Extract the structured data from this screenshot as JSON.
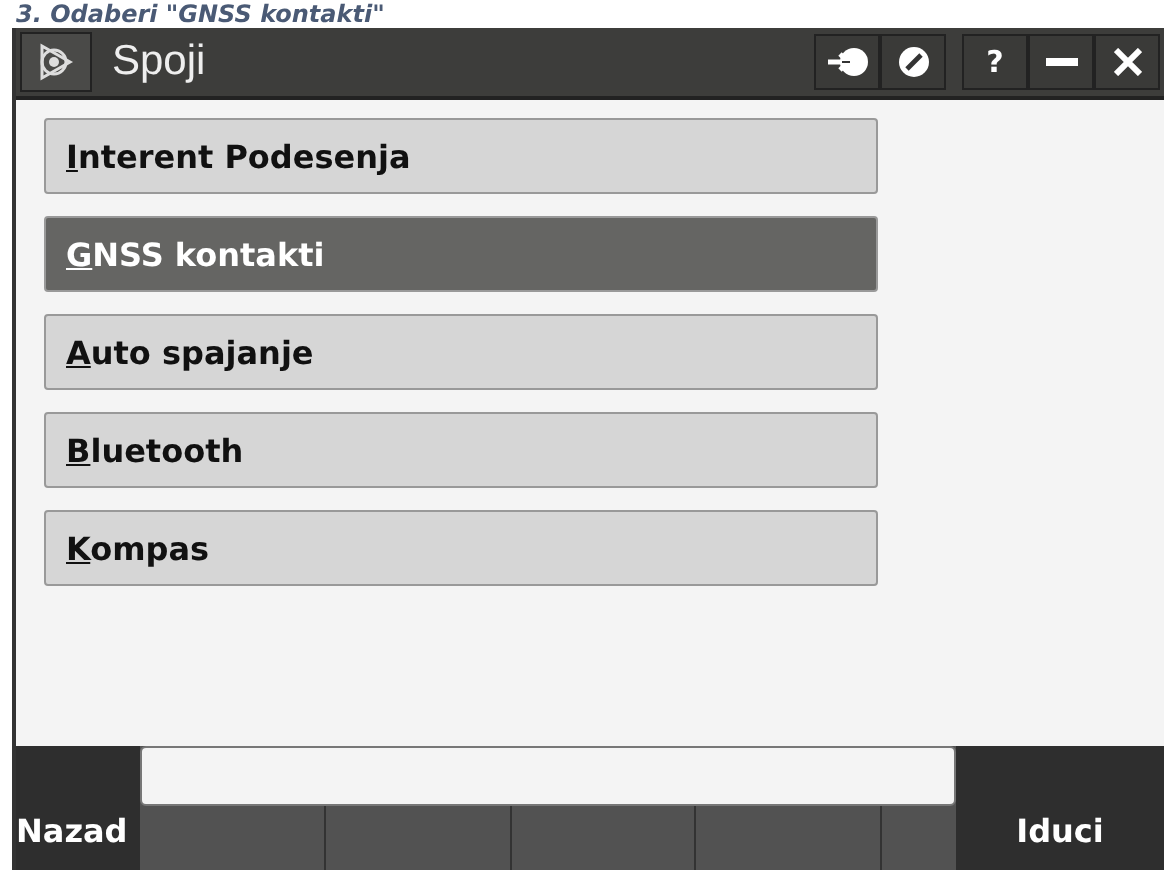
{
  "caption": "3. Odaberi \"GNSS kontakti\"",
  "window": {
    "title": "Spoji",
    "help": "?"
  },
  "menu_items": [
    {
      "label": "Interent Podesenja",
      "selected": false
    },
    {
      "label": "GNSS kontakti",
      "selected": true
    },
    {
      "label": "Auto spajanje",
      "selected": false
    },
    {
      "label": "Bluetooth",
      "selected": false
    },
    {
      "label": "Kompas",
      "selected": false
    }
  ],
  "bottom_bar": {
    "back": "Nazad",
    "next": "Iduci"
  }
}
